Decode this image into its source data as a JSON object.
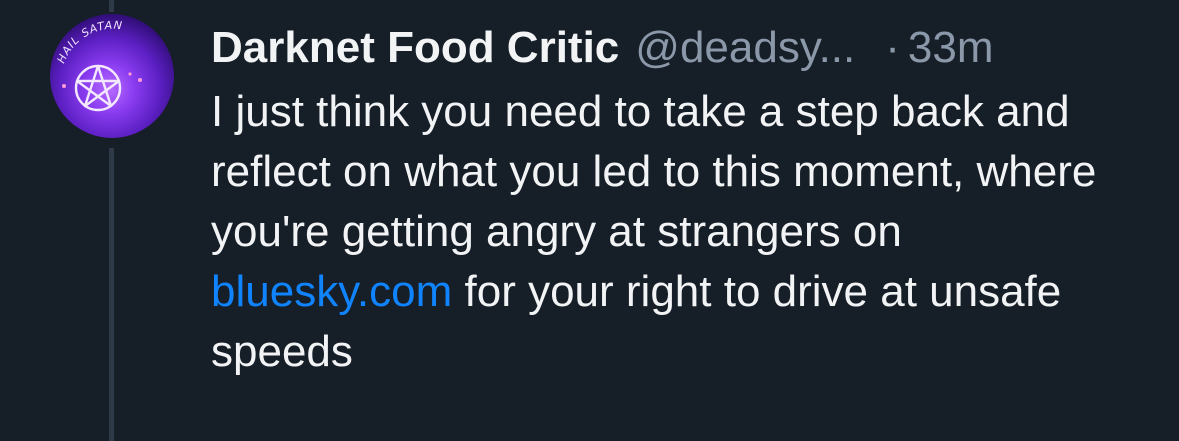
{
  "post": {
    "author": {
      "display_name": "Darknet Food Critic",
      "handle": "@deadsy...",
      "avatar_text": "HAIL SATAN"
    },
    "dot_separator": "·",
    "timestamp": "33m",
    "text_before_link": "I just think you need to take a step back and reflect on what you led to this moment, where you're getting angry at strangers on ",
    "link_text": "bluesky.com",
    "text_after_link": " for your right to drive at unsafe speeds"
  },
  "colors": {
    "background": "#161e27",
    "text_primary": "#f1f3f5",
    "text_secondary": "#8b98a9",
    "link": "#1083fe",
    "thread_line": "#2e3a48"
  }
}
